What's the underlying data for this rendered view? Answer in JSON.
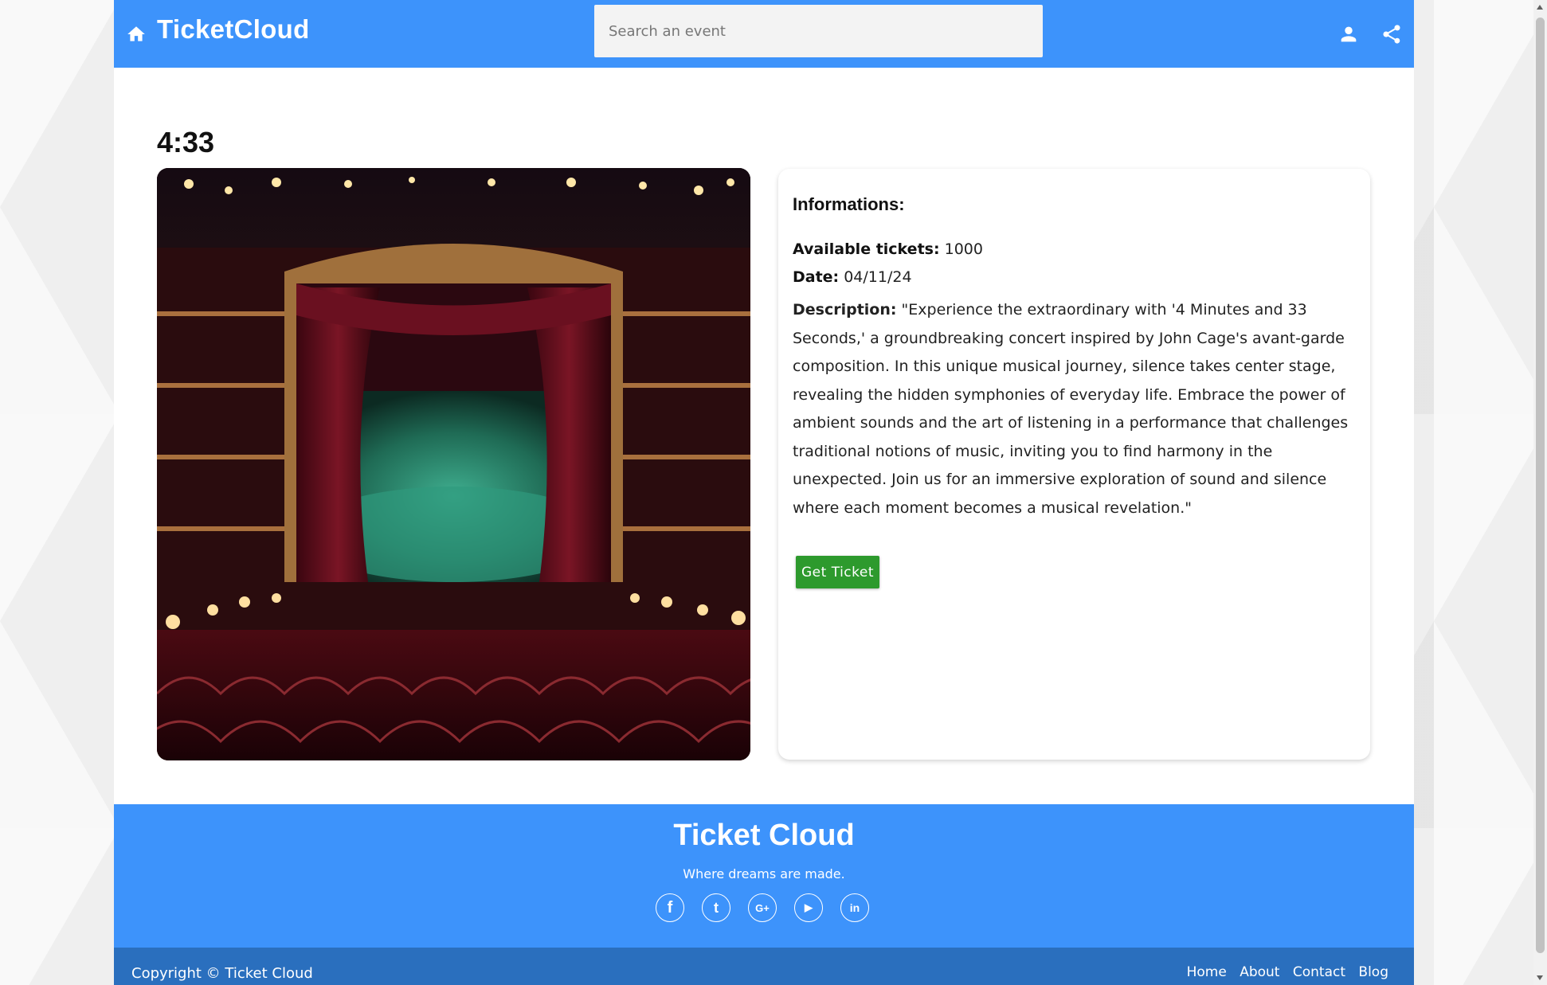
{
  "header": {
    "brand": "TicketCloud",
    "search_placeholder": "Search an event",
    "icons": [
      "home-icon",
      "user-icon",
      "share-icon"
    ]
  },
  "event": {
    "title": "4:33",
    "image_icon": "theater-stage-image",
    "info": {
      "heading": "Informations:",
      "tickets_label": "Available tickets:",
      "tickets_value": "1000",
      "date_label": "Date:",
      "date_value": "04/11/24",
      "description_label": "Description:",
      "description_value": "\"Experience the extraordinary with '4 Minutes and 33 Seconds,' a groundbreaking concert inspired by John Cage's avant-garde composition. In this unique musical journey, silence takes center stage, revealing the hidden symphonies of everyday life. Embrace the power of ambient sounds and the art of listening in a performance that challenges traditional notions of music, inviting you to find harmony in the unexpected. Join us for an immersive exploration of sound and silence where each moment becomes a musical revelation.\""
    },
    "button_label": "Get Ticket"
  },
  "footer": {
    "title": "Ticket Cloud",
    "tagline": "Where dreams are made.",
    "socials": [
      {
        "icon": "facebook-icon",
        "glyph": "f"
      },
      {
        "icon": "twitter-icon",
        "glyph": "t"
      },
      {
        "icon": "google-plus-icon",
        "glyph": "G+"
      },
      {
        "icon": "youtube-icon",
        "glyph": "▶"
      },
      {
        "icon": "linkedin-icon",
        "glyph": "in"
      }
    ],
    "copyright": "Copyright © Ticket Cloud",
    "links": [
      "Home",
      "About",
      "Contact",
      "Blog"
    ]
  },
  "colors": {
    "primary": "#3d93fb",
    "footer_bar": "#2a6fbe",
    "button": "#2d9a2d"
  }
}
